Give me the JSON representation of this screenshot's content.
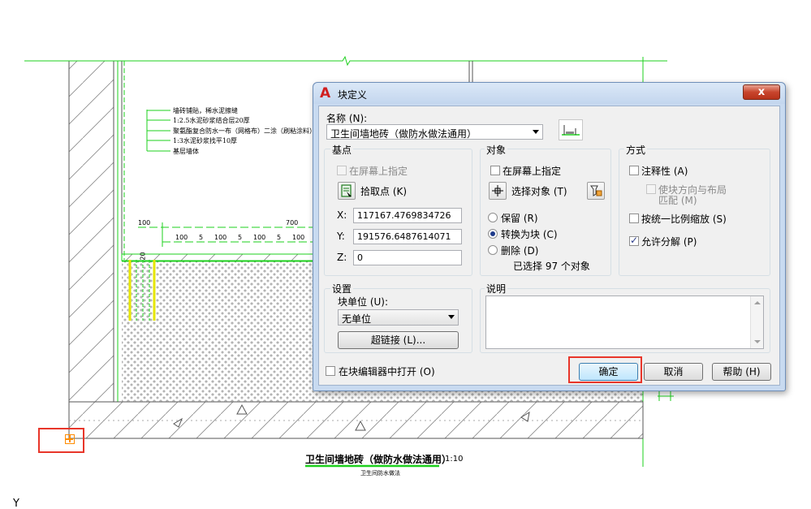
{
  "drawing": {
    "notes": [
      "墙砖铺贴，稀水泥擦缝",
      "1:2.5水泥砂浆结合层20厚",
      "聚氨酯复合防水一布（网格布）二涂（刷粘涂料）二涂（涂粘涂料）",
      "1:3水泥砂浆找平10厚",
      "基层墙体"
    ],
    "dimensions": {
      "left": "100",
      "top": "700",
      "row": [
        "100",
        "5",
        "100",
        "5",
        "100",
        "5",
        "100"
      ],
      "vertical": "20"
    },
    "caption_title": "卫生间墙地砖（做防水做法通用）",
    "caption_scale": "1:10",
    "caption_sub": "卫生间防水做法",
    "ucs_label": "Y",
    "colors": {
      "green": "#1ed01e",
      "yellow": "#e6e600",
      "red": "#e8362a",
      "orange": "#ff8c00",
      "hatch": "#606060"
    }
  },
  "dialog": {
    "title": "块定义",
    "close_label": "x",
    "name_label": "名称 (N):",
    "name_value": "卫生间墙地砖（做防水做法通用）",
    "basepoint": {
      "title": "基点",
      "specify_on_screen": "在屏幕上指定",
      "pick_point": "拾取点 (K)",
      "x_label": "X:",
      "x_value": "117167.4769834726",
      "y_label": "Y:",
      "y_value": "191576.6487614071",
      "z_label": "Z:",
      "z_value": "0"
    },
    "objects": {
      "title": "对象",
      "specify_on_screen": "在屏幕上指定",
      "select_objects": "选择对象 (T)",
      "retain": "保留 (R)",
      "convert": "转换为块 (C)",
      "delete": "删除 (D)",
      "selected_count": "已选择 97 个对象"
    },
    "behavior": {
      "title": "方式",
      "annotative": "注释性 (A)",
      "match_orientation_1": "使块方向与布局",
      "match_orientation_2": "匹配 (M)",
      "scale_uniformly": "按统一比例缩放 (S)",
      "allow_exploding": "允许分解 (P)"
    },
    "settings": {
      "title": "设置",
      "unit_label": "块单位 (U):",
      "unit_value": "无单位",
      "hyperlink": "超链接 (L)..."
    },
    "description": {
      "title": "说明",
      "value": ""
    },
    "open_in_editor": "在块编辑器中打开 (O)",
    "ok": "确定",
    "cancel": "取消",
    "help": "帮助 (H)"
  }
}
